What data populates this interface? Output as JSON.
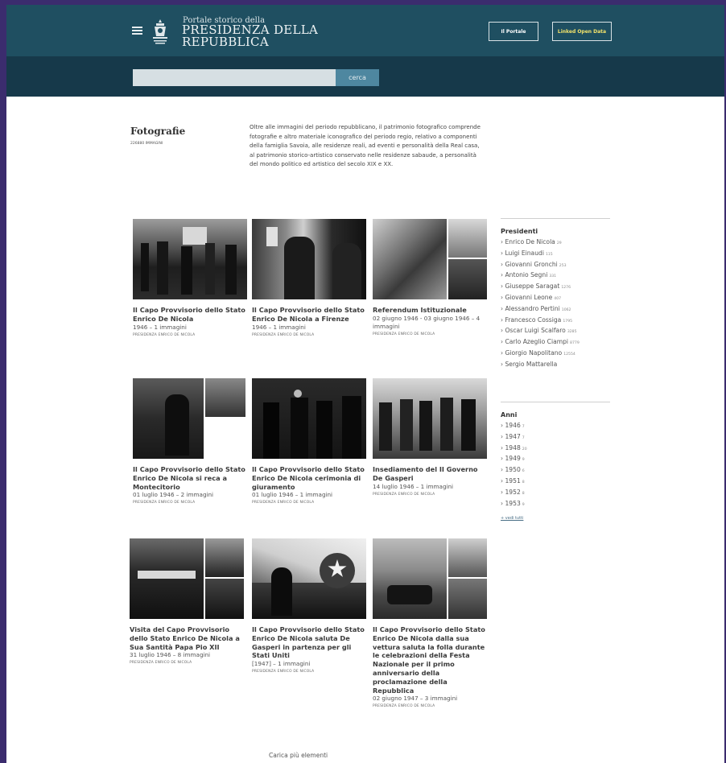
{
  "header": {
    "logo_small": "Portale storico della",
    "logo_line1": "PRESIDENZA DELLA",
    "logo_line2": "REPUBBLICA",
    "btn_portale": "Il Portale",
    "btn_lod": "Linked Open Data"
  },
  "search": {
    "placeholder": "",
    "button": "cerca"
  },
  "section": {
    "title": "Fotografie",
    "count": "226880 IMMAGINI",
    "description": "Oltre alle immagini del periodo repubblicano, il patrimonio fotografico comprende fotografie e altro materiale iconografico del periodo regio, relativo a componenti della famiglia Savoia, alle residenze reali, ad eventi e personalità della Real casa, al patrimonio storico-artistico conservato nelle residenze sabaude, a personalità del mondo politico ed artistico del secolo XIX e XX."
  },
  "cards": [
    {
      "title": "Il Capo Provvisorio dello Stato Enrico De Nicola",
      "meta": "1946 – 1 immagini",
      "collection": "PRESIDENZA ENRICO DE NICOLA"
    },
    {
      "title": "Il Capo Provvisorio dello Stato Enrico De Nicola a Firenze",
      "meta": "1946 – 1 immagini",
      "collection": "PRESIDENZA ENRICO DE NICOLA"
    },
    {
      "title": "Referendum Istituzionale",
      "meta": "02 giugno 1946 - 03 giugno 1946 – 4 immagini",
      "collection": "PRESIDENZA ENRICO DE NICOLA"
    },
    {
      "title": "Il Capo Provvisorio dello Stato Enrico De Nicola si reca a Montecitorio",
      "meta": "01 luglio 1946 – 2 immagini",
      "collection": "PRESIDENZA ENRICO DE NICOLA"
    },
    {
      "title": "Il Capo Provvisorio dello Stato Enrico De Nicola cerimonia di giuramento",
      "meta": "01 luglio 1946 – 1 immagini",
      "collection": "PRESIDENZA ENRICO DE NICOLA"
    },
    {
      "title": "Insediamento del II Governo De Gasperi",
      "meta": "14 luglio 1946 – 1 immagini",
      "collection": "PRESIDENZA ENRICO DE NICOLA"
    },
    {
      "title": "Visita del Capo Provvisorio dello Stato Enrico De Nicola a Sua Santità Papa Pio XII",
      "meta": "31 luglio 1946 – 8 immagini",
      "collection": "PRESIDENZA ENRICO DE NICOLA"
    },
    {
      "title": "Il Capo Provvisorio dello Stato Enrico De Nicola saluta De Gasperi in partenza per gli Stati Uniti",
      "meta": "[1947] – 1 immagini",
      "collection": "PRESIDENZA ENRICO DE NICOLA"
    },
    {
      "title": "Il Capo Provvisorio dello Stato Enrico De Nicola dalla sua vettura saluta la folla durante le celebrazioni della Festa Nazionale per il primo anniversario della proclamazione della Repubblica",
      "meta": "02 giugno 1947 – 3 immagini",
      "collection": "PRESIDENZA ENRICO DE NICOLA"
    }
  ],
  "sidebar": {
    "presidenti_title": "Presidenti",
    "presidenti": [
      {
        "name": "Enrico De Nicola",
        "count": "29"
      },
      {
        "name": "Luigi Einaudi",
        "count": "115"
      },
      {
        "name": "Giovanni Gronchi",
        "count": "253"
      },
      {
        "name": "Antonio Segni",
        "count": "331"
      },
      {
        "name": "Giuseppe Saragat",
        "count": "1276"
      },
      {
        "name": "Giovanni Leone",
        "count": "407"
      },
      {
        "name": "Alessandro Pertini",
        "count": "1062"
      },
      {
        "name": "Francesco Cossiga",
        "count": "1795"
      },
      {
        "name": "Oscar Luigi Scalfaro",
        "count": "3285"
      },
      {
        "name": "Carlo Azeglio Ciampi",
        "count": "8779"
      },
      {
        "name": "Giorgio Napolitano",
        "count": "12554"
      },
      {
        "name": "Sergio Mattarella",
        "count": ""
      }
    ],
    "anni_title": "Anni",
    "anni": [
      {
        "name": "1946",
        "count": "7"
      },
      {
        "name": "1947",
        "count": "7"
      },
      {
        "name": "1948",
        "count": "20"
      },
      {
        "name": "1949",
        "count": "9"
      },
      {
        "name": "1950",
        "count": "6"
      },
      {
        "name": "1951",
        "count": "8"
      },
      {
        "name": "1952",
        "count": "8"
      },
      {
        "name": "1953",
        "count": "9"
      }
    ],
    "see_all": "+ vedi tutti"
  },
  "load_more": "Carica più elementi"
}
